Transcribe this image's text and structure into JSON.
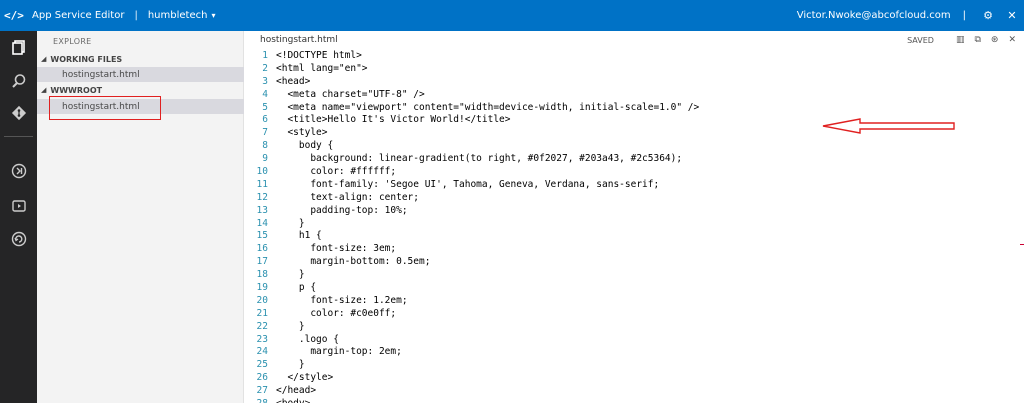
{
  "topbar": {
    "logo": "</>",
    "app_title": "App Service Editor",
    "separator": "|",
    "site_name": "humbletech",
    "caret": "▾",
    "user_email": "Victor.Nwoke@abcofcloud.com",
    "divider": "|",
    "settings_icon": "⚙",
    "close_icon": "✕"
  },
  "activity_bar": {
    "items": [
      {
        "name": "explore-icon",
        "glyph": "❐"
      },
      {
        "name": "search-icon",
        "glyph": "⌕"
      },
      {
        "name": "git-icon",
        "glyph": "◆"
      },
      {
        "name": "output-icon",
        "glyph": "⇥"
      },
      {
        "name": "console-icon",
        "glyph": "▷"
      },
      {
        "name": "run-icon",
        "glyph": "↻"
      }
    ]
  },
  "sidebar": {
    "title": "EXPLORE",
    "sections": [
      {
        "label": "WORKING FILES",
        "files": [
          "hostingstart.html"
        ]
      },
      {
        "label": "WWWROOT",
        "files": [
          "hostingstart.html"
        ]
      }
    ],
    "expand_glyph": "◢"
  },
  "editor": {
    "tab_name": "hostingstart.html",
    "saved_label": "SAVED",
    "action_icons": [
      "▥",
      "⧉",
      "⊛",
      "✕"
    ]
  },
  "code_lines": [
    "<!DOCTYPE html>",
    "<html lang=\"en\">",
    "<head>",
    "  <meta charset=\"UTF-8\" />",
    "  <meta name=\"viewport\" content=\"width=device-width, initial-scale=1.0\" />",
    "  <title>Hello It's Victor World!</title>",
    "  <style>",
    "    body {",
    "      background: linear-gradient(to right, #0f2027, #203a43, #2c5364);",
    "      color: #ffffff;",
    "      font-family: 'Segoe UI', Tahoma, Geneva, Verdana, sans-serif;",
    "      text-align: center;",
    "      padding-top: 10%;",
    "    }",
    "    h1 {",
    "      font-size: 3em;",
    "      margin-bottom: 0.5em;",
    "    }",
    "    p {",
    "      font-size: 1.2em;",
    "      color: #c0e0ff;",
    "    }",
    "    .logo {",
    "      margin-top: 2em;",
    "    }",
    "  </style>",
    "</head>",
    "<body>"
  ],
  "colors": {
    "topbar_bg": "#0072c6",
    "activity_bg": "#252526",
    "sidebar_bg": "#f3f3f3",
    "selected_file_bg": "#d9d9df",
    "highlight": "#e02020",
    "line_number": "#2b91af"
  }
}
